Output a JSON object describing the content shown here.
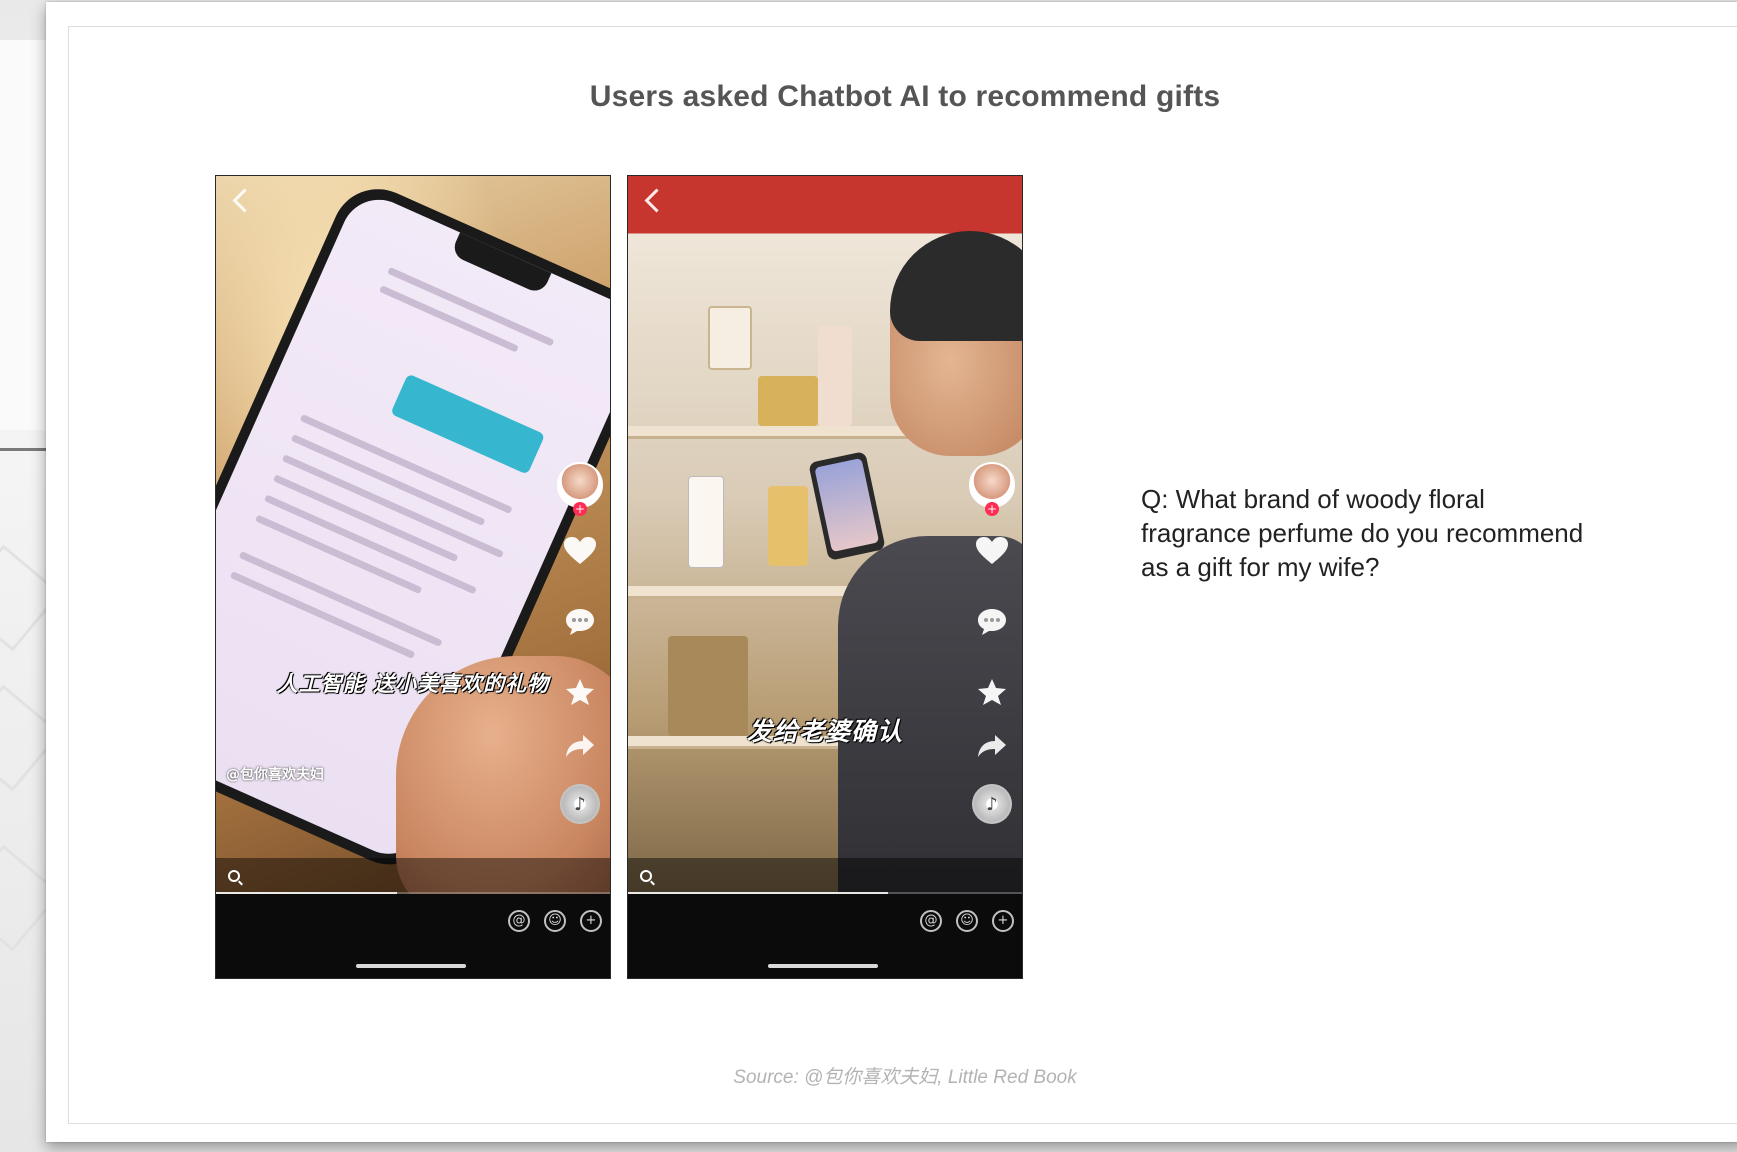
{
  "slide": {
    "title": "Users asked Chatbot AI to recommend gifts",
    "question": "Q: What brand of woody floral fragrance perfume do you recommend as a gift for my wife?",
    "source": "Source: @包你喜欢夫妇, Little Red Book"
  },
  "phones": [
    {
      "top_title": "",
      "top_right": "",
      "caption": "人工智能 送小美喜欢的礼物",
      "author": "@包你喜欢夫妇",
      "description": "",
      "tags": "",
      "search": "",
      "comment_placeholder": "",
      "side_counts": {
        "like": "",
        "comment": ""
      },
      "progress": 0.46
    },
    {
      "top_title": "",
      "top_right": "",
      "caption": "发给老婆确认",
      "author": "",
      "description": "",
      "tags": "",
      "search": "",
      "comment_placeholder": "",
      "side_counts": {
        "like": "",
        "comment": ""
      },
      "progress": 0.66
    }
  ],
  "icons": {
    "back": "back-chevron-icon",
    "avatar": "creator-avatar",
    "like": "heart-icon",
    "comment": "comment-bubble-icon",
    "favorite": "star-icon",
    "share": "share-arrow-icon",
    "music": "music-disc-icon",
    "search": "search-icon",
    "mention": "at-icon",
    "emoji": "emoji-icon",
    "add": "plus-circle-icon"
  },
  "colors": {
    "title": "#555555",
    "source": "#b3b3b3",
    "chat_bubble": "#36b7cf",
    "follow_badge": "#ff2d55"
  }
}
